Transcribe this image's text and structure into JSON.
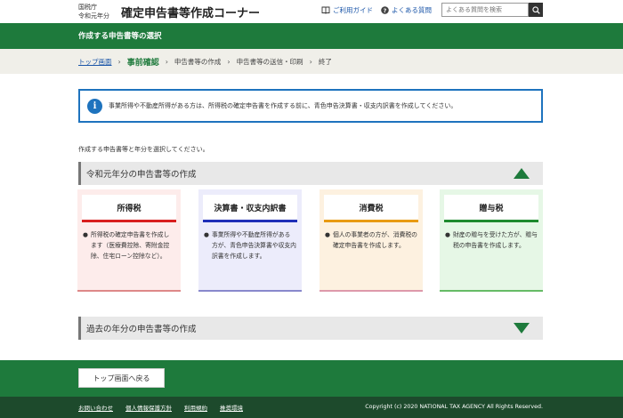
{
  "header": {
    "agency_line1": "国税庁",
    "agency_line2": "令和元年分",
    "title": "確定申告書等作成コーナー",
    "guide_link": "ご利用ガイド",
    "faq_link": "よくある質問",
    "search_placeholder": "よくある質問を検索"
  },
  "page_heading": "作成する申告書等の選択",
  "breadcrumb": {
    "top": "トップ画面",
    "current": "事前確認",
    "step3": "申告書等の作成",
    "step4": "申告書等の送信・印刷",
    "step5": "終了",
    "sep": "›"
  },
  "notice": {
    "icon": "i",
    "text": "事業所得や不動産所得がある方は、所得税の確定申告書を作成する前に、青色申告決算書・収支内訳書を作成してください。"
  },
  "instruction": "作成する申告書等と年分を選択してください。",
  "current_section": {
    "title": "令和元年分の申告書等の作成",
    "cards": [
      {
        "title": "所得税",
        "desc": "所得税の確定申告書を作成します（医療費控除、寄附金控除、住宅ローン控除など）。",
        "bg": "#fdeceb",
        "accent": "#d81e1e",
        "bottom": "#d88"
      },
      {
        "title": "決算書・収支内訳書",
        "desc": "事業所得や不動産所得がある方が、青色申告決算書や収支内訳書を作成します。",
        "bg": "#ececfb",
        "accent": "#1f2fb8",
        "bottom": "#88c"
      },
      {
        "title": "消費税",
        "desc": "個人の事業者の方が、消費税の確定申告書を作成します。",
        "bg": "#fdf1e0",
        "accent": "#e89a12",
        "bottom": "#d9a"
      },
      {
        "title": "贈与税",
        "desc": "財産の贈与を受けた方が、贈与税の申告書を作成します。",
        "bg": "#e6f7e6",
        "accent": "#1e8a2e",
        "bottom": "#6b6"
      }
    ]
  },
  "past_section": {
    "title": "過去の年分の申告書等の作成"
  },
  "footer": {
    "back_button": "トップ画面へ戻る",
    "links": [
      "お問い合わせ",
      "個人情報保護方針",
      "利用規約",
      "推奨環境"
    ],
    "copyright": "Copyright (c) 2020 NATIONAL TAX AGENCY All Rights Reserved."
  },
  "colors": {
    "brand_green": "#1e7a3c",
    "footer_dark": "#1d4a2c",
    "info_blue": "#1e73be"
  }
}
